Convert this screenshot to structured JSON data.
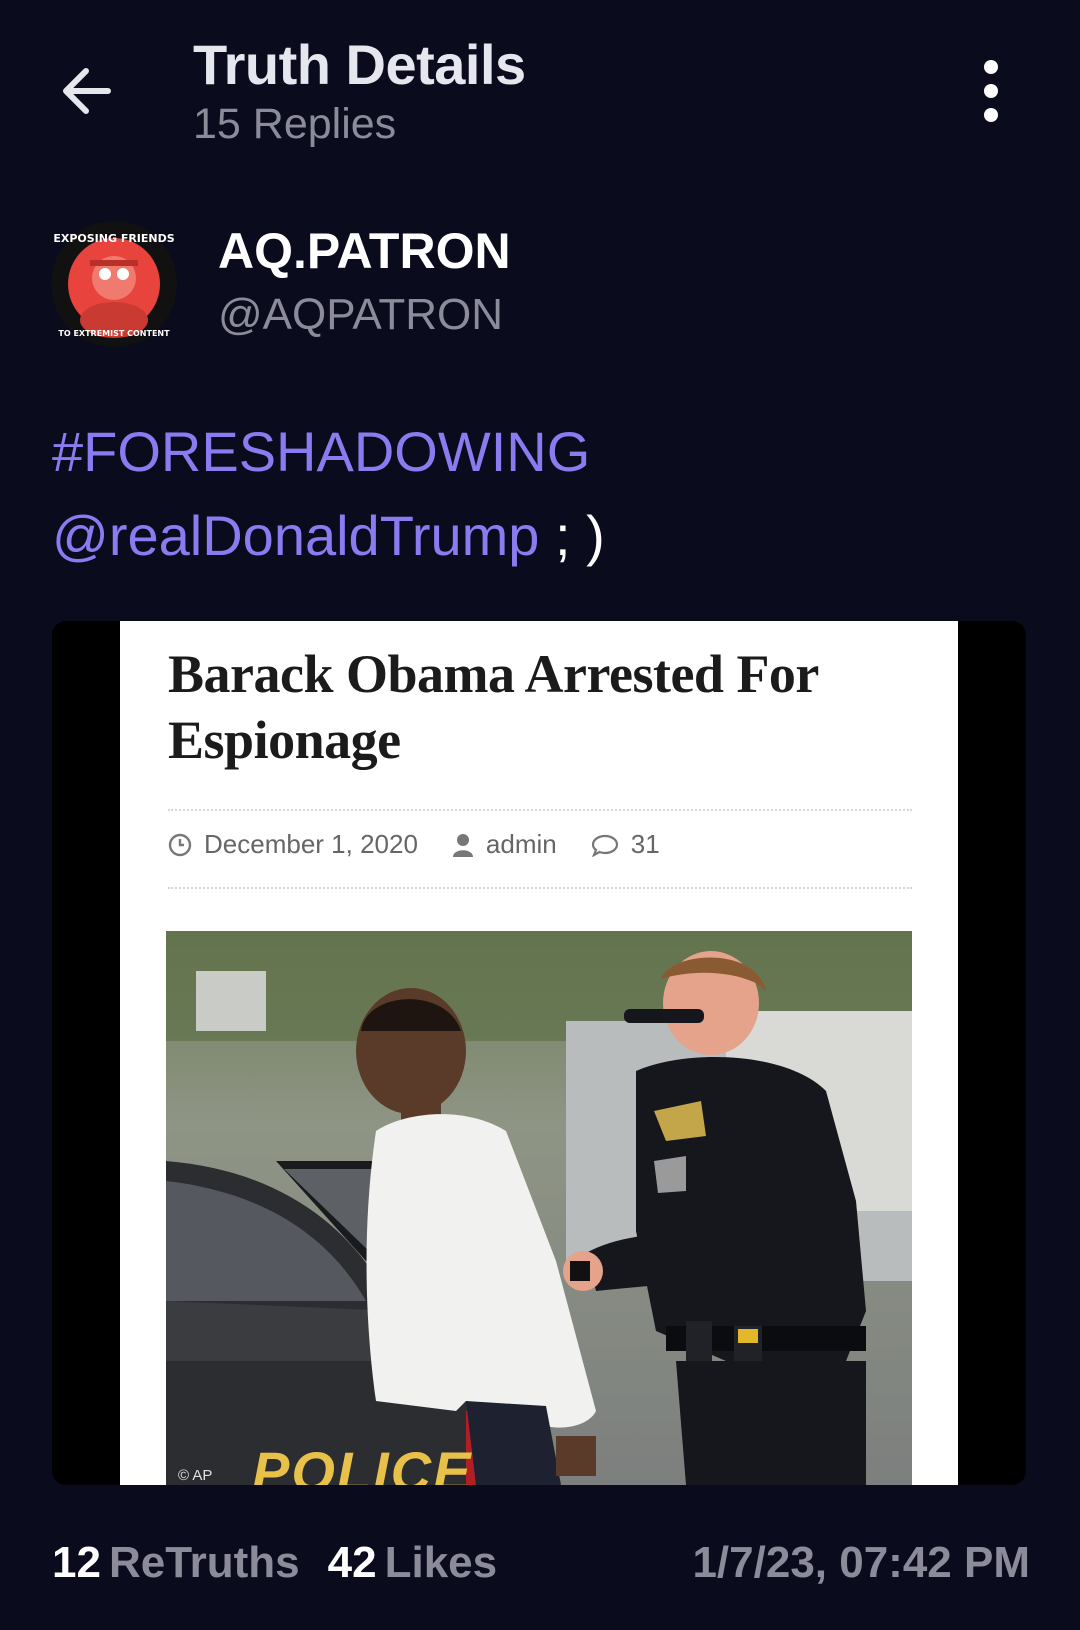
{
  "header": {
    "title": "Truth Details",
    "replies": "15 Replies",
    "back_icon": "arrow-left-icon",
    "more_icon": "more-vertical-icon"
  },
  "author": {
    "name": "AQ.PATRON",
    "handle": "@AQPATRON",
    "avatar_ring_text_top": "EXPOSING FRIENDS",
    "avatar_ring_text_bottom": "TO EXTREMIST CONTENT"
  },
  "post": {
    "hashtag": "#FORESHADOWING",
    "mention": "@realDonaldTrump",
    "suffix": " ; )"
  },
  "media": {
    "headline": "Barack Obama Arrested For Espionage",
    "date": "December 1, 2020",
    "author": "admin",
    "comments": "31",
    "photo_text": "POLICE",
    "photo_credit": "© AP"
  },
  "stats": {
    "retruths_count": "12",
    "retruths_label": "ReTruths",
    "likes_count": "42",
    "likes_label": "Likes",
    "timestamp": "1/7/23, 07:42 PM"
  },
  "colors": {
    "background": "#0b0b1e",
    "accent": "#8a7cf0",
    "muted": "#8b8b9a"
  }
}
